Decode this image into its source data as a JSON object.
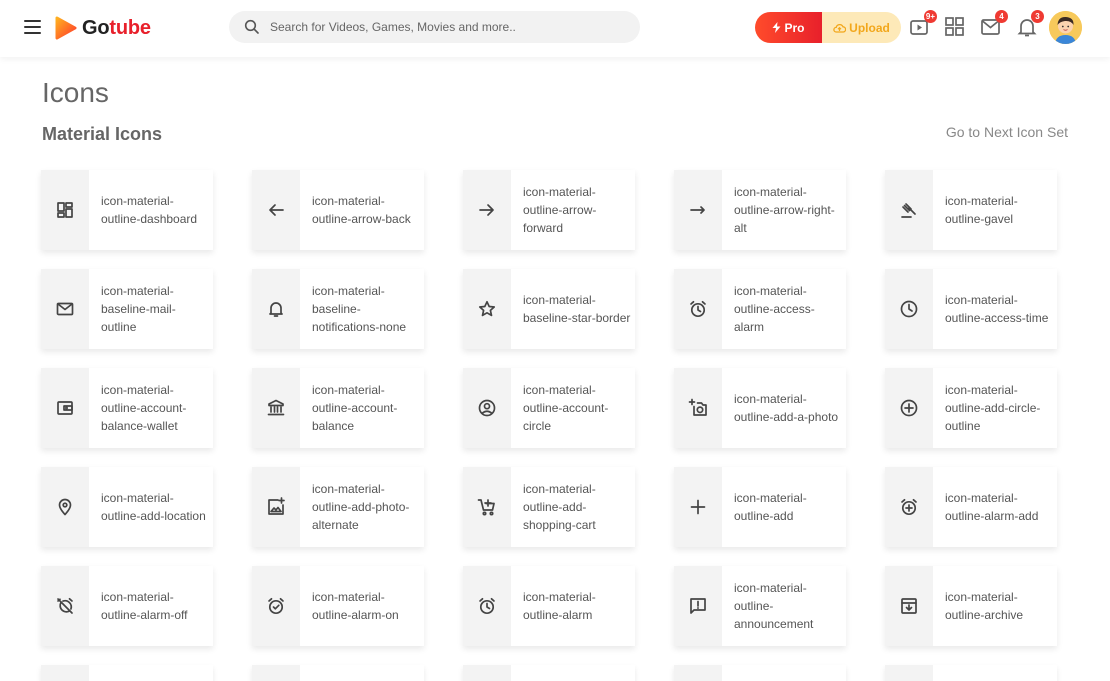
{
  "header": {
    "logo_text_part1": "Go",
    "logo_text_part2": "tube",
    "search_placeholder": "Search for Videos, Games, Movies and more..",
    "pro_label": "Pro",
    "upload_label": "Upload",
    "video_badge": "9+",
    "mail_badge": "4",
    "notification_badge": "3",
    "brand_color": "#e8202b",
    "upload_color": "#f2a71b"
  },
  "page": {
    "title": "Icons",
    "section_title": "Material Icons",
    "next_link": "Go to Next Icon Set"
  },
  "icons": [
    {
      "icon": "dashboard",
      "label": "icon-material-outline-dashboard"
    },
    {
      "icon": "arrow-back",
      "label": "icon-material-outline-arrow-back"
    },
    {
      "icon": "arrow-forward",
      "label": "icon-material-outline-arrow-forward"
    },
    {
      "icon": "arrow-right-alt",
      "label": "icon-material-outline-arrow-right-alt"
    },
    {
      "icon": "gavel",
      "label": "icon-material-outline-gavel"
    },
    {
      "icon": "mail",
      "label": "icon-material-baseline-mail-outline"
    },
    {
      "icon": "bell",
      "label": "icon-material-baseline-notifications-none"
    },
    {
      "icon": "star",
      "label": "icon-material-baseline-star-border"
    },
    {
      "icon": "access-alarm",
      "label": "icon-material-outline-access-alarm"
    },
    {
      "icon": "access-time",
      "label": "icon-material-outline-access-time"
    },
    {
      "icon": "wallet",
      "label": "icon-material-outline-account-balance-wallet"
    },
    {
      "icon": "bank",
      "label": "icon-material-outline-account-balance"
    },
    {
      "icon": "account-circle",
      "label": "icon-material-outline-account-circle"
    },
    {
      "icon": "add-a-photo",
      "label": "icon-material-outline-add-a-photo"
    },
    {
      "icon": "add-circle",
      "label": "icon-material-outline-add-circle-outline"
    },
    {
      "icon": "location",
      "label": "icon-material-outline-add-location"
    },
    {
      "icon": "add-photo-alternate",
      "label": "icon-material-outline-add-photo-alternate"
    },
    {
      "icon": "shopping-cart",
      "label": "icon-material-outline-add-shopping-cart"
    },
    {
      "icon": "add",
      "label": "icon-material-outline-add"
    },
    {
      "icon": "alarm-add",
      "label": "icon-material-outline-alarm-add"
    },
    {
      "icon": "alarm-off",
      "label": "icon-material-outline-alarm-off"
    },
    {
      "icon": "alarm-on",
      "label": "icon-material-outline-alarm-on"
    },
    {
      "icon": "alarm",
      "label": "icon-material-outline-alarm"
    },
    {
      "icon": "announcement",
      "label": "icon-material-outline-announcement"
    },
    {
      "icon": "archive",
      "label": "icon-material-outline-archive"
    }
  ]
}
